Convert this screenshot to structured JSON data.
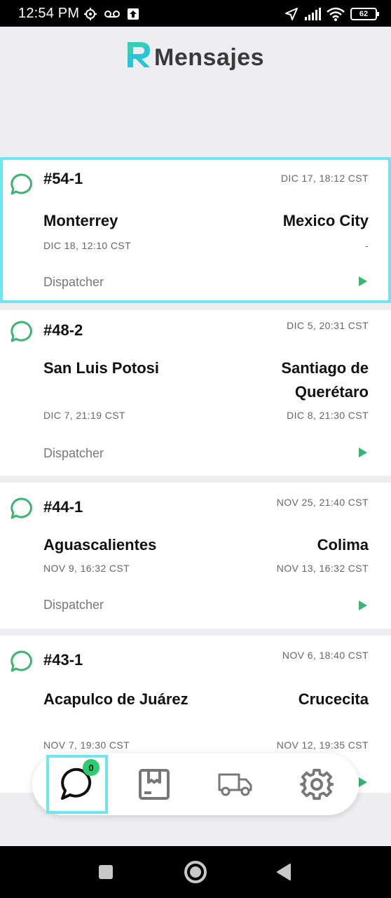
{
  "status_bar": {
    "time": "12:54 PM",
    "battery": "62",
    "icons_left": [
      "gear-icon",
      "voicemail-icon",
      "upload-icon"
    ],
    "icons_right": [
      "location-arrow-icon",
      "signal-icon",
      "wifi-icon",
      "battery-icon"
    ]
  },
  "header": {
    "title": "Mensajes",
    "logo_color": "#26c6da"
  },
  "colors": {
    "accent_green": "#3cb371",
    "selection_outline": "#6fe6ef",
    "badge_green": "#2ecc71"
  },
  "messages": [
    {
      "order": "#54-1",
      "created": "DIC 17, 18:12 CST",
      "origin": "Monterrey",
      "origin_date": "DIC 18, 12:10 CST",
      "destination": "Mexico City",
      "destination_date": "-",
      "role": "Dispatcher",
      "selected": true
    },
    {
      "order": "#48-2",
      "created": "DIC 5, 20:31 CST",
      "origin": "San Luis Potosi",
      "origin_date": "DIC 7, 21:19 CST",
      "destination": "Santiago de Querétaro",
      "destination_date": "DIC 8, 21:30 CST",
      "role": "Dispatcher",
      "selected": false
    },
    {
      "order": "#44-1",
      "created": "NOV 25, 21:40 CST",
      "origin": "Aguascalientes",
      "origin_date": "NOV 9, 16:32 CST",
      "destination": "Colima",
      "destination_date": "NOV 13, 16:32 CST",
      "role": "Dispatcher",
      "selected": false
    },
    {
      "order": "#43-1",
      "created": "NOV 6, 18:40 CST",
      "origin": "Acapulco de Juárez",
      "origin_date": "NOV 7, 19:30 CST",
      "destination": "Crucecita",
      "destination_date": "NOV 12, 19:35 CST",
      "role": "",
      "selected": false
    }
  ],
  "bottom_nav": {
    "items": [
      {
        "icon": "chat-icon",
        "active": true,
        "badge": "0"
      },
      {
        "icon": "box-icon",
        "active": false
      },
      {
        "icon": "truck-icon",
        "active": false
      },
      {
        "icon": "gear-icon",
        "active": false
      }
    ]
  },
  "system_nav": [
    "square-icon",
    "home-circle-icon",
    "back-triangle-icon"
  ]
}
